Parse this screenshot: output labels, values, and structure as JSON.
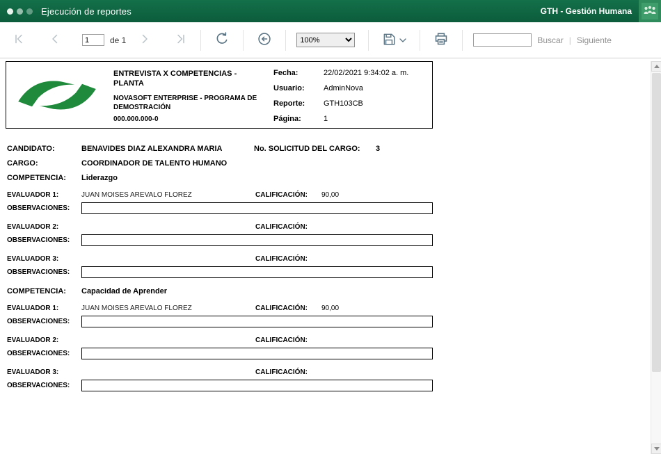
{
  "colors": {
    "titlebar_green": "#0e6742",
    "logo_green": "#1f8a3c",
    "icon_slate": "#5b7484",
    "icon_disabled": "#b9c2c8"
  },
  "window": {
    "title": "Ejecución de reportes",
    "app_badge": "GTH - Gestión Humana"
  },
  "toolbar": {
    "page_value": "1",
    "page_of_label": "de 1",
    "zoom_value": "100%",
    "search_value": "",
    "buscar_label": "Buscar",
    "divider": "|",
    "siguiente_label": "Siguiente"
  },
  "report_header": {
    "title": "ENTREVISTA X COMPETENCIAS - PLANTA",
    "subtitle": "NOVASOFT ENTERPRISE  - PROGRAMA DE DEMOSTRACIÓN",
    "nit": "000.000.000-0",
    "fecha_label": "Fecha:",
    "fecha_value": "22/02/2021 9:34:02 a. m.",
    "usuario_label": "Usuario:",
    "usuario_value": "AdminNova",
    "reporte_label": "Reporte:",
    "reporte_value": "GTH103CB",
    "pagina_label": "Página:",
    "pagina_value": "1"
  },
  "body": {
    "candidato_label": "CANDIDATO:",
    "candidato_value": "BENAVIDES DIAZ ALEXANDRA MARIA",
    "solicitud_label": "No. SOLICITUD DEL CARGO:",
    "solicitud_value": "3",
    "cargo_label": "CARGO:",
    "cargo_value": "COORDINADOR DE TALENTO HUMANO",
    "competencia_label": "COMPETENCIA:",
    "calificacion_label": "CALIFICACIÓN:",
    "observaciones_label": "OBSERVACIONES:",
    "competencies": [
      {
        "name": "Liderazgo",
        "evaluators": [
          {
            "label": "EVALUADOR 1:",
            "name": "JUAN  MOISES AREVALO  FLOREZ",
            "score": "90,00"
          },
          {
            "label": "EVALUADOR 2:",
            "name": "",
            "score": ""
          },
          {
            "label": "EVALUADOR 3:",
            "name": "",
            "score": ""
          }
        ]
      },
      {
        "name": "Capacidad de Aprender",
        "evaluators": [
          {
            "label": "EVALUADOR 1:",
            "name": "JUAN  MOISES AREVALO  FLOREZ",
            "score": "90,00"
          },
          {
            "label": "EVALUADOR 2:",
            "name": "",
            "score": ""
          },
          {
            "label": "EVALUADOR 3:",
            "name": "",
            "score": ""
          }
        ]
      }
    ]
  }
}
